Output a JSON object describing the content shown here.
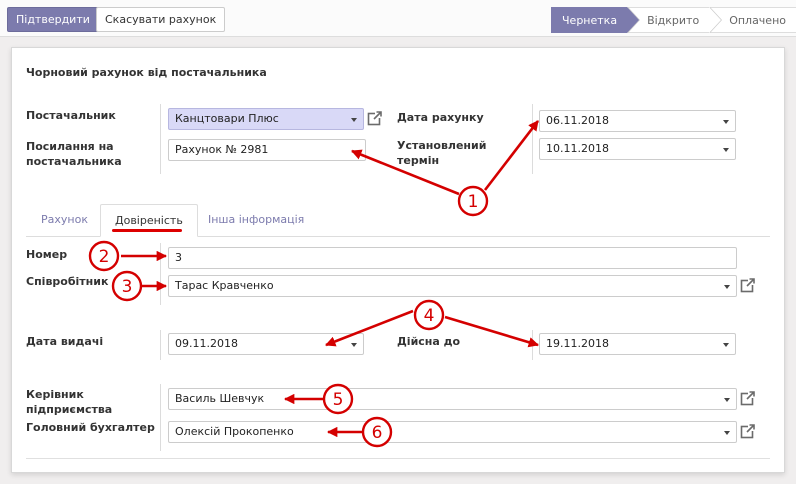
{
  "toolbar": {
    "confirm_label": "Підтвердити",
    "cancel_label": "Скасувати рахунок"
  },
  "statusbar": {
    "stages": [
      "Чернетка",
      "Відкрито",
      "Оплачено"
    ],
    "active": "Чернетка"
  },
  "form": {
    "title": "Чорновий рахунок від постачальника",
    "supplier_label": "Постачальник",
    "supplier_value": "Канцтовари Плюс",
    "reference_label": "Посилання на постачальника",
    "reference_value": "Рахунок № 2981",
    "invoice_date_label": "Дата рахунку",
    "invoice_date_value": "06.11.2018",
    "due_date_label": "Установлений термін",
    "due_date_value": "10.11.2018"
  },
  "tabs": [
    "Рахунок",
    "Довіреність",
    "Інша інформація"
  ],
  "active_tab": "Довіреність",
  "proxy": {
    "number_label": "Номер",
    "number_value": "3",
    "employee_label": "Співробітник",
    "employee_value": "Тарас Кравченко",
    "issue_date_label": "Дата видачі",
    "issue_date_value": "09.11.2018",
    "valid_until_label": "Дійсна до",
    "valid_until_value": "19.11.2018",
    "director_label": "Керівник підприємства",
    "director_value": "Василь Шевчук",
    "accountant_label": "Головний бухгалтер",
    "accountant_value": "Олексій Прокопенко"
  },
  "annotations": [
    "1",
    "2",
    "3",
    "4",
    "5",
    "6"
  ],
  "colors": {
    "accent": "#7c7bad",
    "annotation": "#d40000",
    "highlight": "#d9d9f7"
  },
  "icons": [
    "external-link-icon",
    "dropdown-caret-icon"
  ]
}
